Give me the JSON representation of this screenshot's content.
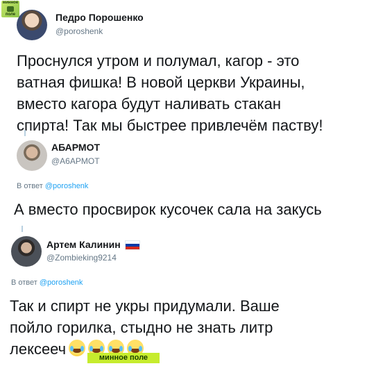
{
  "watermark": {
    "top_line1": "минное",
    "top_line2": "поле",
    "bottom": "минное поле"
  },
  "tweet": {
    "author_name": "Педро Порошенко",
    "author_handle": "@poroshenk",
    "text": "Проснулся утром и полумал, кагор - это\nватная фишка! В новой церкви Украины,\nвместо кагора будут наливать стакан\nспирта! Так мы быстрее привлечём паству!"
  },
  "replies": [
    {
      "author_name": "АБАРМОТ",
      "author_handle": "@A6APMOT",
      "reply_prefix": "В ответ",
      "reply_to": "@poroshenk",
      "text": "А вместо просвирок кусочек сала на закусь"
    },
    {
      "author_name": "Артем Калинин",
      "author_handle": "@Zombieking9214",
      "reply_prefix": "В ответ",
      "reply_to": "@poroshenk",
      "text": "Так и спирт не укры придумали. Ваше\nпойло горилка, стыдно не знать литр\nлексееч",
      "flag_colors": [
        "#ffffff",
        "#0039a6",
        "#d52b1e"
      ],
      "emoji_icons": [
        "face-with-tears-of-joy-icon",
        "face-with-tears-of-joy-icon",
        "face-with-tears-of-joy-icon",
        "face-with-tears-of-joy-icon"
      ]
    }
  ],
  "colors": {
    "text": "#14171a",
    "secondary": "#657786",
    "link": "#1da1f2",
    "watermark_bg": "#c6ec2d"
  }
}
